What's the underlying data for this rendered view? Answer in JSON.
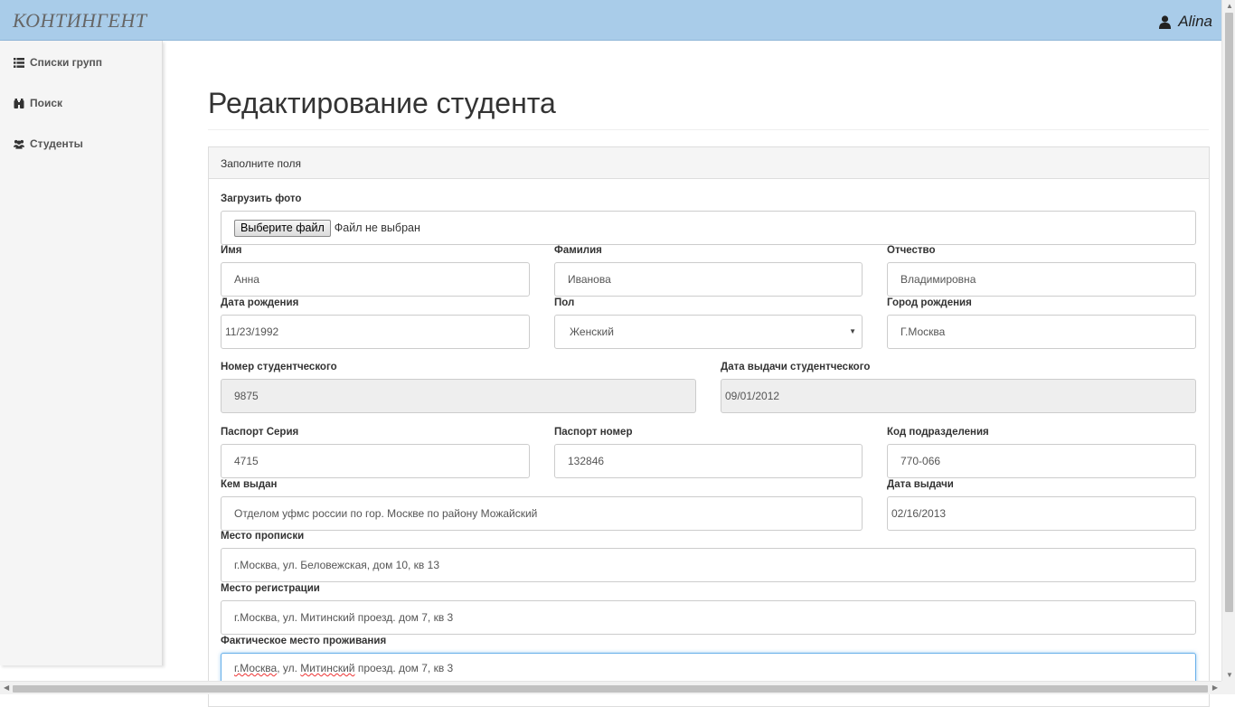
{
  "app": {
    "brand": "КОНТИНГЕНТ",
    "user_name": "Alina"
  },
  "sidebar": {
    "items": [
      {
        "label": "Списки групп",
        "icon": "list-icon"
      },
      {
        "label": "Поиск",
        "icon": "binoculars-icon"
      },
      {
        "label": "Студенты",
        "icon": "users-icon"
      }
    ]
  },
  "page": {
    "title": "Редактирование студента",
    "panel_heading": "Заполните поля"
  },
  "form": {
    "photo": {
      "label": "Загрузить фото",
      "button": "Выберите файл",
      "status": "Файл не выбран"
    },
    "first_name": {
      "label": "Имя",
      "value": "Анна"
    },
    "last_name": {
      "label": "Фамилия",
      "value": "Иванова"
    },
    "patronymic": {
      "label": "Отчество",
      "value": "Владимировна"
    },
    "birth_date": {
      "label": "Дата рождения",
      "value": "11/23/1992"
    },
    "gender": {
      "label": "Пол",
      "value": "Женский"
    },
    "birth_city": {
      "label": "Город рождения",
      "value": "Г.Москва"
    },
    "student_id": {
      "label": "Номер студентческого",
      "value": "9875"
    },
    "student_id_date": {
      "label": "Дата выдачи студентческого",
      "value": "09/01/2012"
    },
    "passport_series": {
      "label": "Паспорт Серия",
      "value": "4715"
    },
    "passport_number": {
      "label": "Паспорт номер",
      "value": "132846"
    },
    "division_code": {
      "label": "Код подразделения",
      "value": "770-066"
    },
    "issued_by": {
      "label": "Кем выдан",
      "value": "Отделом уфмс россии по гор. Москве по району Можайский"
    },
    "issue_date": {
      "label": "Дата выдачи",
      "value": "02/16/2013"
    },
    "permanent_address": {
      "label": "Место прописки",
      "value": "г.Москва, ул. Беловежская, дом 10, кв 13"
    },
    "registration_address": {
      "label": "Место регистрации",
      "value": "г.Москва, ул. Митинский проезд. дом 7, кв 3"
    },
    "actual_address": {
      "label": "Фактическое место проживания",
      "value_part1": "г.Москва",
      "value_part2": ", ул. ",
      "value_part3": "Митинский",
      "value_part4": " проезд. дом 7, кв 3"
    }
  },
  "colors": {
    "navbar": "#a9cce9",
    "sidebar": "#f5f5f5",
    "readonly": "#eeeeee",
    "focus": "#66afe9"
  }
}
